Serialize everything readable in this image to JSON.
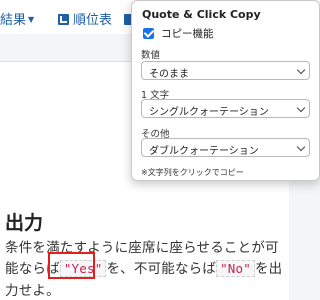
{
  "nav": {
    "results_label": "結果",
    "ranking_label": "順位表",
    "more_label": "パ"
  },
  "problem": {
    "section_title": "出力",
    "line1": "条件を満たすように座席に座らせることが可",
    "line2_prefix": "能ならば",
    "yes_code": "\"Yes\"",
    "line2_mid": "を、不可能ならば",
    "no_code": "\"No\"",
    "line2_suffix": "を出",
    "line3": "力せよ。"
  },
  "popup": {
    "title": "Quote & Click Copy",
    "enable_label": "コピー機能",
    "enable_checked": true,
    "numeric_label": "数値",
    "numeric_value": "そのまま",
    "one_char_label": "1 文字",
    "one_char_value": "シングルクォーテーション",
    "other_label": "その他",
    "other_value": "ダブルクォーテーション",
    "note": "※文字列をクリックでコピー"
  },
  "colors": {
    "accent": "#1a73e8",
    "nav_link": "#1f5fa6",
    "highlight_box": "#e32119",
    "code_text": "#c7254e"
  }
}
